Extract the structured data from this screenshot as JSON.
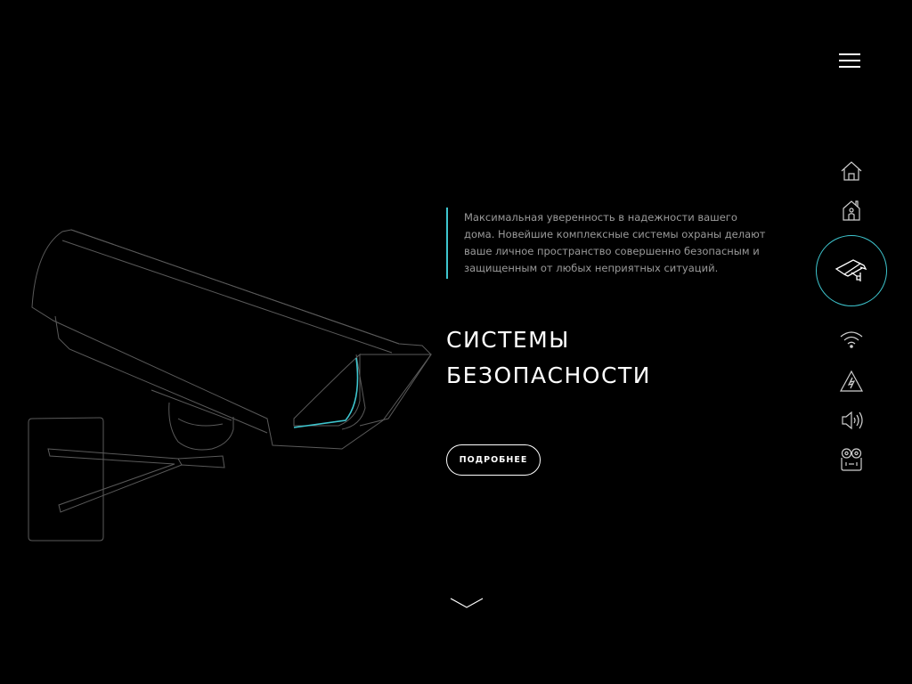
{
  "header": {
    "menu_icon": "hamburger-menu-icon"
  },
  "hero": {
    "description": "Максимальная уверенность в надежности вашего дома. Новейшие комплексные системы охраны делают ваше личное пространство совершенно безопасным и защищенным от любых неприятных ситуаций.",
    "title_line1": "СИСТЕМЫ",
    "title_line2": "БЕЗОПАСНОСТИ",
    "more_button": "ПОДРОБНЕЕ",
    "illustration": "security-camera"
  },
  "nav": {
    "items": [
      {
        "icon": "home-icon"
      },
      {
        "icon": "house-person-icon"
      },
      {
        "icon": "security-camera-icon",
        "active": true
      },
      {
        "icon": "wifi-icon"
      },
      {
        "icon": "warning-lightning-icon"
      },
      {
        "icon": "speaker-icon"
      },
      {
        "icon": "intercom-icon"
      }
    ]
  },
  "scroll": {
    "icon": "chevron-down-icon"
  },
  "colors": {
    "background": "#000000",
    "accent": "#3ec6cf",
    "text": "#ffffff",
    "muted_text": "#9a9a9a"
  }
}
